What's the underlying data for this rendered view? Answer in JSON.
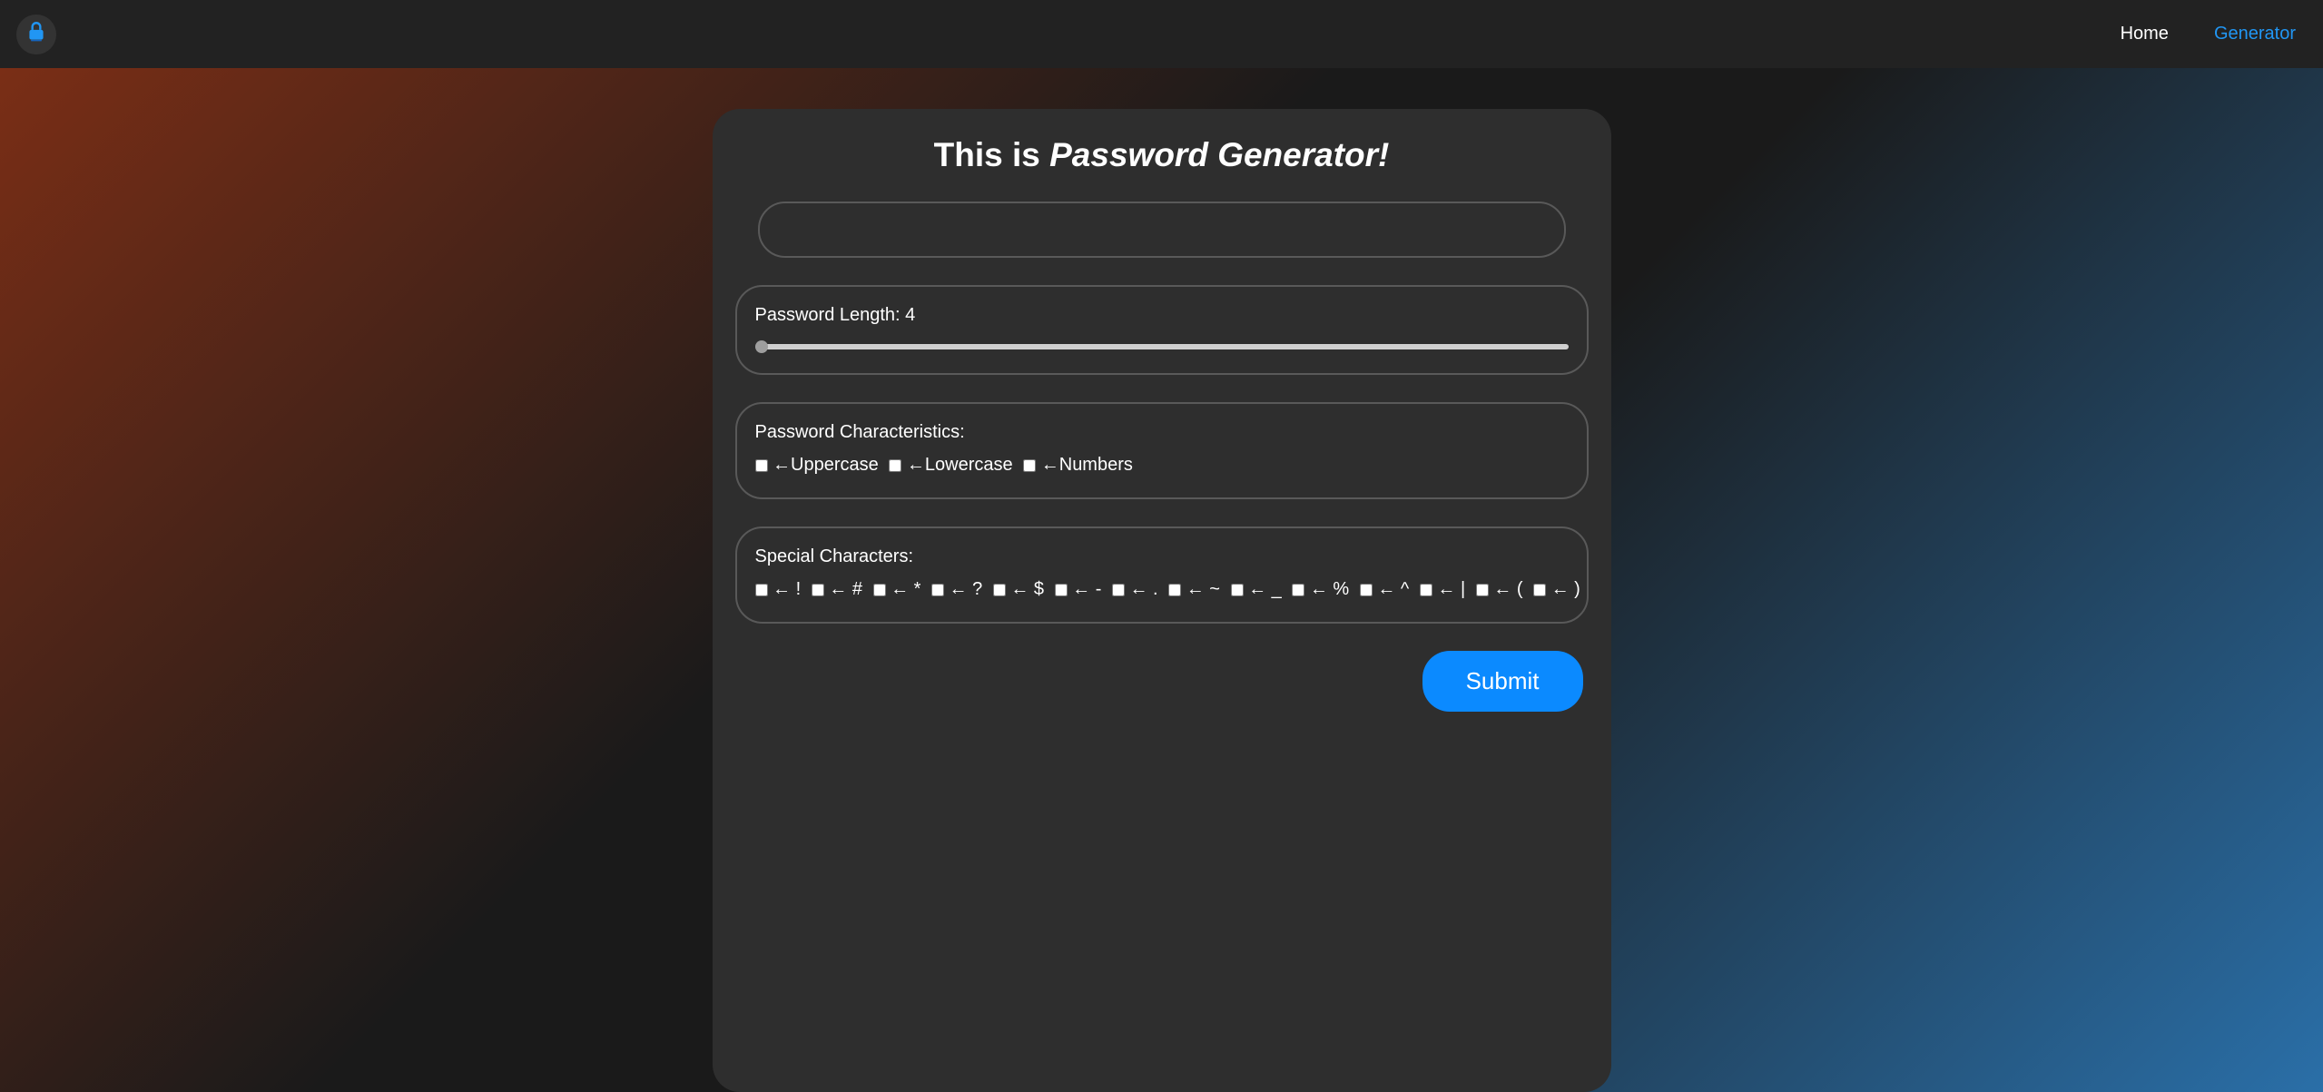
{
  "nav": {
    "home": "Home",
    "generator": "Generator"
  },
  "title_prefix": "This is ",
  "title_em": "Password Generator!",
  "output_value": "",
  "length": {
    "label_prefix": "Password Length: ",
    "value": 4,
    "min": 4,
    "max": 128
  },
  "characteristics": {
    "label": "Password Characteristics:",
    "arrow": "←",
    "options": [
      "Uppercase",
      "Lowercase",
      "Numbers"
    ]
  },
  "specials": {
    "label": "Special Characters:",
    "arrow": "←",
    "options": [
      "!",
      "#",
      "*",
      "?",
      "$",
      "-",
      ".",
      "~",
      "_",
      "%",
      "^",
      "|",
      "(",
      ")"
    ]
  },
  "submit_label": "Submit"
}
